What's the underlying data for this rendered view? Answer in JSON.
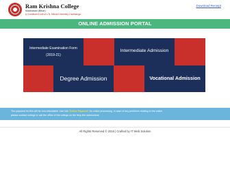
{
  "header": {
    "college_name": "Ram Krishna College",
    "subtitle": "Madhubani (Bihar)",
    "affiliation": "A Constituent Unit of L.N. Mithila University, Darbhanga",
    "download_link": "Download Receipt"
  },
  "portal_title": "ONLINE ADMISSION PORTAL",
  "tiles": {
    "intermediate_form_line1": "Intermediate Examination Form",
    "intermediate_form_line2": "(2019-21)",
    "intermediate_admission": "Intermediate Admission",
    "degree_admission": "Degree Admission",
    "vocational_admission": "Vocational Admission"
  },
  "notice": {
    "line1_pre": "The payment for this will be non-refundable. Use link",
    "line1_link": "'Online Payment'",
    "line1_post": "for online processing. In case of any problems relating to the online",
    "line2": "please contact college or call the office of the college on the help line admissions."
  },
  "footer": {
    "copyright": "All Rights Reserved © 2016 | Crafted by IT Web Solution"
  },
  "colors": {
    "accent_green": "#4bb77e",
    "tile_navy": "#1b2f5a",
    "tile_red": "#c9302c",
    "notice_blue": "#6bb5dc"
  }
}
